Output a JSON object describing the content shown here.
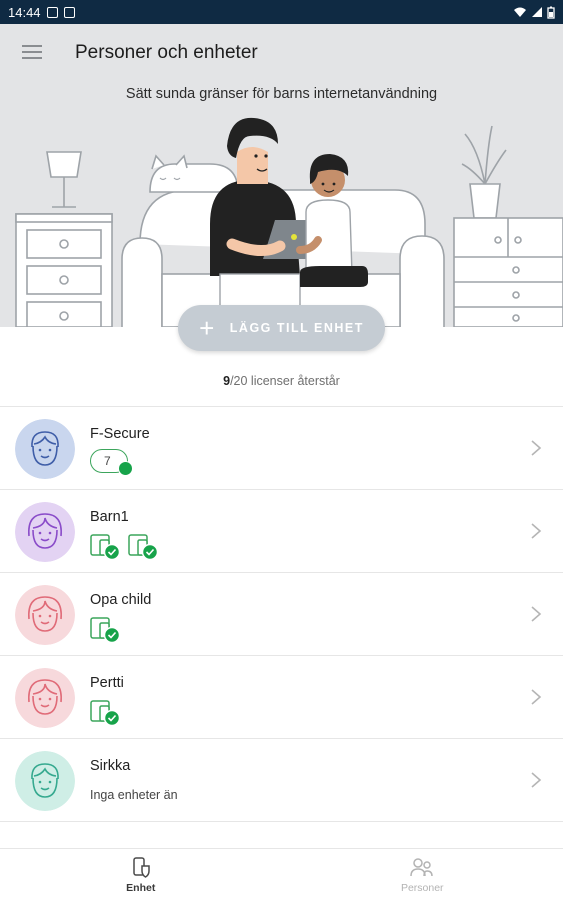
{
  "status_bar": {
    "time": "14:44"
  },
  "header": {
    "title": "Personer och enheter",
    "subtitle": "Sätt sunda gränser för barns internetanvändning"
  },
  "add_device_button": {
    "label": "LÄGG TILL ENHET"
  },
  "licenses": {
    "remaining": "9",
    "total_text": "/20 licenser återstår"
  },
  "people": [
    {
      "name": "F-Secure",
      "avatar_color": "#c9d6ee",
      "icon_color": "#3f5ea8",
      "device_count": "7"
    },
    {
      "name": "Barn1",
      "avatar_color": "#e3d3f3",
      "icon_color": "#8a4cc9",
      "devices": 2
    },
    {
      "name": "Opa child",
      "avatar_color": "#f7d9dc",
      "icon_color": "#e06b78",
      "devices": 1
    },
    {
      "name": "Pertti",
      "avatar_color": "#f7d9dc",
      "icon_color": "#e06b78",
      "devices": 1
    },
    {
      "name": "Sirkka",
      "avatar_color": "#cfeee6",
      "icon_color": "#35a98f",
      "status": "Inga enheter än"
    }
  ],
  "bottom_nav": [
    {
      "label": "Enhet",
      "icon": "device-shield-icon",
      "active": true
    },
    {
      "label": "Personer",
      "icon": "people-icon",
      "active": false
    }
  ],
  "colors": {
    "status_bar": "#0f2a43",
    "hero_bg": "#e3e4e6",
    "check_green": "#17a34a",
    "button_bg": "#c5ccd3"
  }
}
